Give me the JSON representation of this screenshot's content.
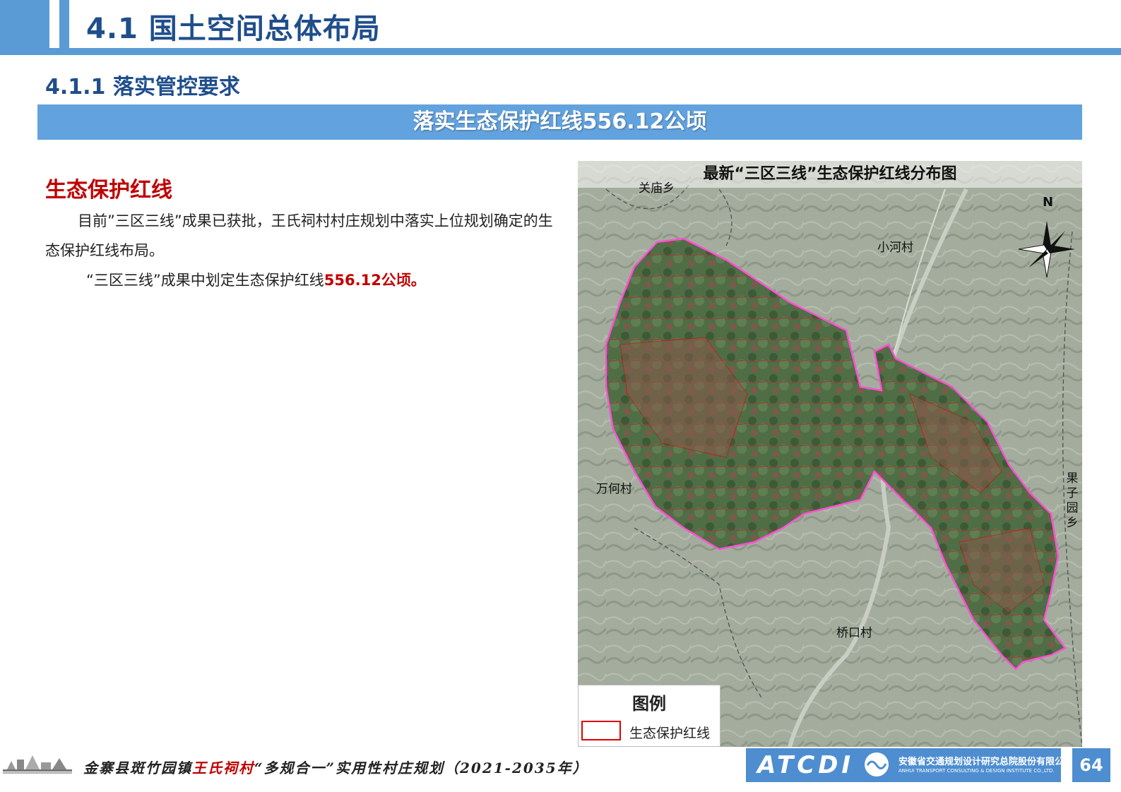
{
  "header": {
    "title": "4.1 国土空间总体布局"
  },
  "subtitle": "4.1.1 落实管控要求",
  "banner": "落实生态保护红线556.12公顷",
  "section": {
    "heading": "生态保护红线",
    "para1": "目前”三区三线”成果已获批，王氏祠村村庄规划中落实上位规划确定的生态保护红线布局。",
    "para2_prefix": "“三区三线”成果中划定生态保护红线",
    "para2_highlight": "556.12公顷。"
  },
  "map": {
    "title": "最新“三区三线”生态保护红线分布图",
    "labels": {
      "guanmiao": "关庙乡",
      "xiaohe": "小河村",
      "wanhe": "万何村",
      "qiaokou": "桥口村",
      "guoziyuan": "果子园乡",
      "north": "N"
    },
    "legend": {
      "title": "图例",
      "item": "生态保护红线",
      "swatch_color": "#e00000"
    }
  },
  "footer": {
    "text_prefix": "金寨县斑竹园镇",
    "text_highlight": "王氏祠村",
    "text_suffix": "“多规合一”实用性村庄规划（2021-2035年）",
    "logo_name": "ATCDI",
    "logo_cn": "安徽省交通规划设计研究总院股份有限公司",
    "logo_en": "ANHUI TRANSPORT CONSULTING & DESIGN INSTITUTE CO.,LTD.",
    "page_number": "64"
  },
  "colors": {
    "accent": "#5b9bd5",
    "title_blue": "#1f4e8c",
    "highlight_red": "#c00000",
    "boundary_pink": "#ff4fd8"
  }
}
